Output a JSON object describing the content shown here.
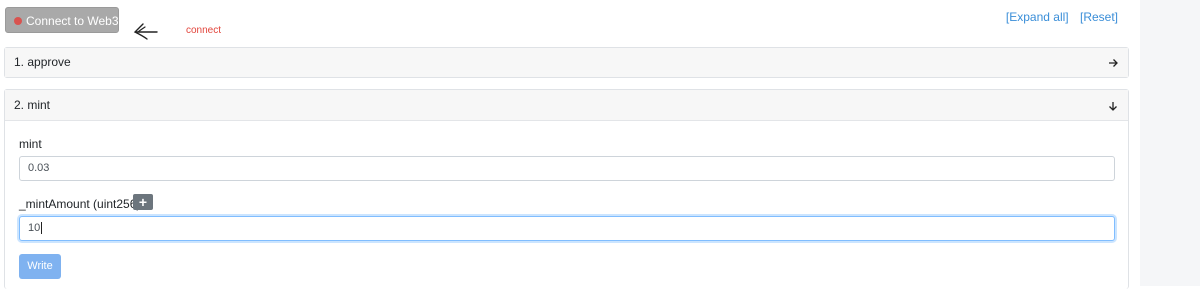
{
  "toolbar": {
    "connect_label": "Connect to Web3",
    "annotation": "connect",
    "expand_all": "[Expand all]",
    "reset": "[Reset]"
  },
  "functions": [
    {
      "title": "1. approve",
      "expanded": false
    },
    {
      "title": "2. mint",
      "expanded": true
    }
  ],
  "mint_form": {
    "payable_label": "mint",
    "payable_value": "0.03",
    "param_label": "_mintAmount (uint256)",
    "add_symbol": "+",
    "param_value": "10",
    "write_label": "Write"
  },
  "colors": {
    "connect_dot": "#d9534f",
    "annotation": "#e2453c",
    "link": "#3a8ed8",
    "write_button": "#7fb2f0"
  },
  "icons": {
    "collapsed": "arrow-right-icon",
    "expanded": "arrow-down-icon",
    "annotation": "hand-drawn-arrow-icon"
  }
}
